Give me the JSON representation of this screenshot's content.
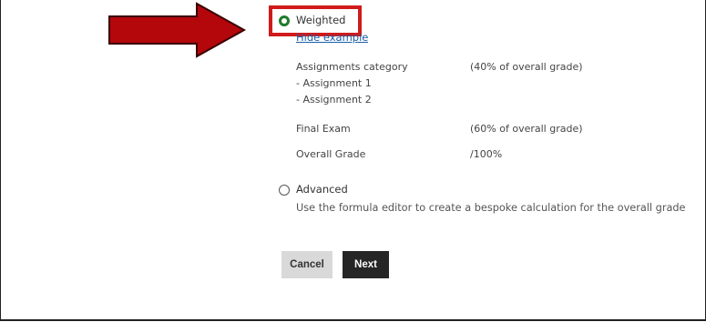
{
  "weighting": {
    "weighted_label": "Weighted",
    "hide_example_link": "Hide example",
    "example": {
      "assignments_category": "Assignments category",
      "assignments_category_share": "(40% of overall grade)",
      "assignment_1": "- Assignment 1",
      "assignment_2": "- Assignment 2",
      "final_exam": "Final Exam",
      "final_exam_share": "(60% of overall grade)",
      "overall_grade": "Overall Grade",
      "overall_grade_value": "/100%"
    },
    "advanced_label": "Advanced",
    "advanced_description": "Use the formula editor to create a bespoke calculation for the overall grade"
  },
  "buttons": {
    "cancel_label": "Cancel",
    "next_label": "Next"
  },
  "colors": {
    "highlight": "#d11a1a",
    "arrow": "#b3070c",
    "selected_radio": "#1f7a2a",
    "link": "#1b5fa8",
    "next_button": "#262626",
    "cancel_button": "#d9d9d9"
  }
}
